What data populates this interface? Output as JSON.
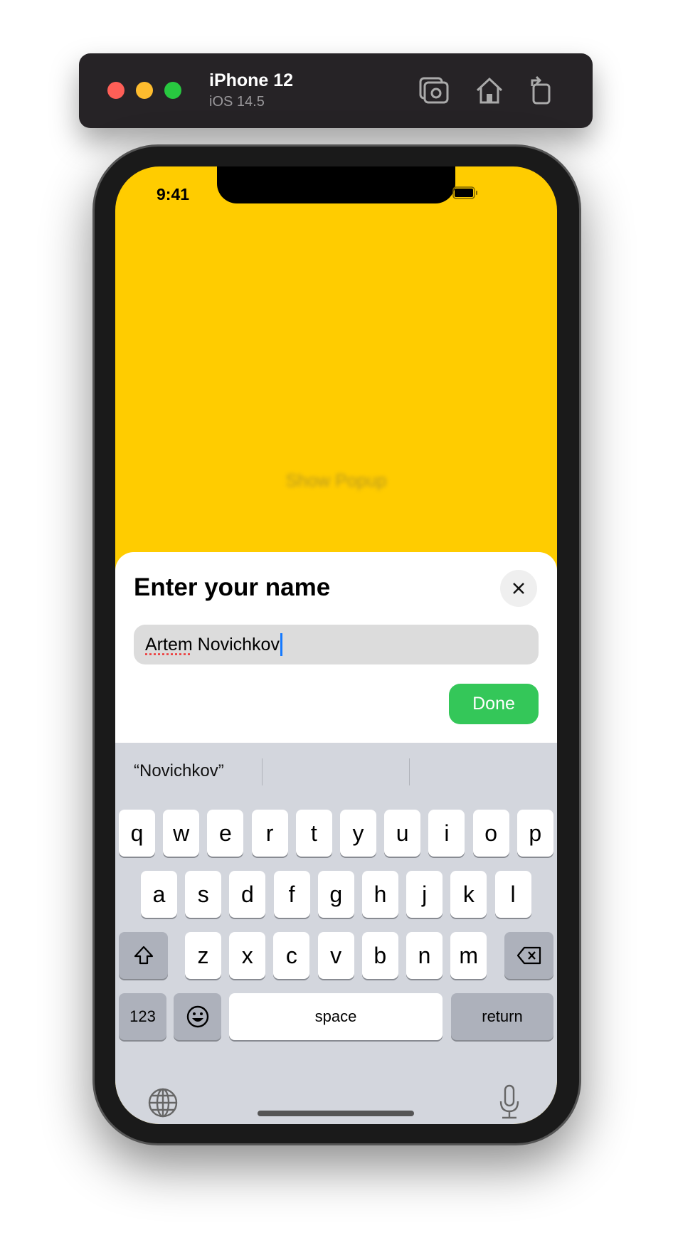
{
  "simulator": {
    "device": "iPhone 12",
    "os": "iOS 14.5",
    "traffic_lights": [
      "#fe5f57",
      "#febc2e",
      "#28c840"
    ],
    "icons": [
      "screenshot-icon",
      "home-icon",
      "rotate-icon"
    ]
  },
  "status_bar": {
    "time": "9:41"
  },
  "background": {
    "color": "#ffcc00",
    "button_label": "Show Popup"
  },
  "popup": {
    "title": "Enter your name",
    "input_value_misspelled": "Artem",
    "input_value_rest": " Novichkov",
    "done_label": "Done",
    "done_color": "#34c759"
  },
  "keyboard": {
    "suggestions": [
      "“Novichkov”",
      "",
      ""
    ],
    "row1": [
      "q",
      "w",
      "e",
      "r",
      "t",
      "y",
      "u",
      "i",
      "o",
      "p"
    ],
    "row2": [
      "a",
      "s",
      "d",
      "f",
      "g",
      "h",
      "j",
      "k",
      "l"
    ],
    "row3": [
      "z",
      "x",
      "c",
      "v",
      "b",
      "n",
      "m"
    ],
    "numbers_label": "123",
    "space_label": "space",
    "return_label": "return"
  }
}
